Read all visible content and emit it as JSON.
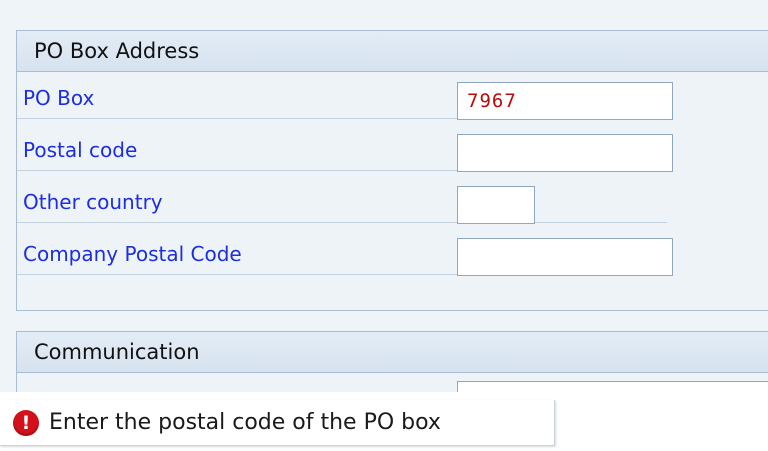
{
  "po_box_section": {
    "title": "PO Box Address",
    "fields": [
      {
        "label": "PO Box",
        "value": "7967"
      },
      {
        "label": "Postal code",
        "value": ""
      },
      {
        "label": "Other country",
        "value": ""
      },
      {
        "label": "Company Postal Code",
        "value": ""
      }
    ]
  },
  "communication_section": {
    "title": "Communication"
  },
  "status_bar": {
    "icon": "error-icon",
    "icon_glyph": "!",
    "message": "Enter the postal code of the PO box"
  },
  "colors": {
    "label_blue": "#1c2ee0",
    "value_red": "#b80b0b",
    "error_red": "#d4111b",
    "screen_bg": "#eff4f9"
  }
}
